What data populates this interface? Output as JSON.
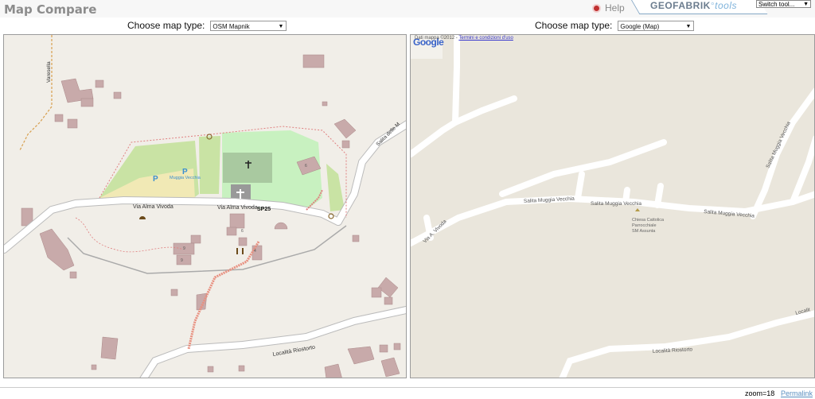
{
  "app": {
    "title": "Map Compare"
  },
  "header": {
    "help_label": "Help",
    "brand_name": "GEOFABRIK",
    "brand_suffix": "tools",
    "switch_tool": "Switch tool..."
  },
  "left": {
    "choose_label": "Choose map type:",
    "selected": "OSM Mapnik",
    "labels": {
      "road1": "Via Alma Vivoda",
      "road2": "Via Alma Vivoda",
      "sp": "SP25",
      "salita": "Salita delle M",
      "varesella": "Varesella",
      "localita": "Località Riostorto",
      "parking1": "P",
      "parking2": "P",
      "muggia": "Muggia Vecchia",
      "num1": "9",
      "num2": "9",
      "num3": "6",
      "num4": "4",
      "num5": "6"
    }
  },
  "right": {
    "choose_label": "Choose map type:",
    "selected": "Google (Map)",
    "attribution": "Dati mappa ©2012 -",
    "terms": "Termini e condizioni d'uso",
    "logo": "Google",
    "labels": {
      "salita1": "Salita Muggia Vecchia",
      "salita2": "Salita Muggia Vecchia",
      "salita3": "Salita Muggia Vecchia",
      "salita4": "Salita Muggia Vecchia",
      "via": "Via A. Vivoda",
      "church1": "Chiesa Cattolica",
      "church2": "Parrocchiale",
      "church3": "SM Assunta",
      "localita": "Località Riostorto",
      "localita2": "Localit"
    }
  },
  "footer": {
    "zoom": "zoom=18",
    "permalink": "Permalink"
  }
}
